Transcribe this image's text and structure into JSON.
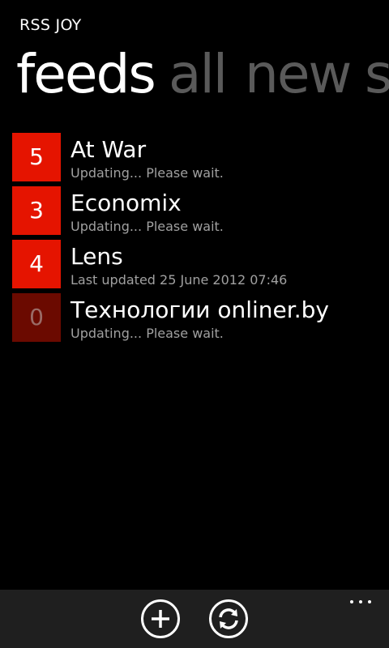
{
  "app_title": "RSS JOY",
  "pivot": [
    {
      "label": "feeds",
      "active": true
    },
    {
      "label": "all",
      "active": false
    },
    {
      "label": "new",
      "active": false
    },
    {
      "label": "s",
      "active": false
    }
  ],
  "feeds": [
    {
      "count": "5",
      "name": "At War",
      "status": "Updating... Please wait."
    },
    {
      "count": "3",
      "name": "Economix",
      "status": "Updating... Please wait."
    },
    {
      "count": "4",
      "name": "Lens",
      "status": "Last updated 25 June 2012 07:46"
    },
    {
      "count": "0",
      "name": "Технологии onliner.by",
      "status": "Updating... Please wait."
    }
  ],
  "appbar": {
    "buttons": [
      {
        "icon": "add-icon"
      },
      {
        "icon": "refresh-icon"
      }
    ],
    "more_icon": "ellipsis-icon"
  },
  "colors": {
    "accent": "#e51400",
    "accent_dim": "#6b0a00",
    "background": "#000000",
    "secondary_text": "#a0a0a0",
    "inactive_pivot": "#5a5a5a",
    "appbar": "#1f1f1f"
  }
}
